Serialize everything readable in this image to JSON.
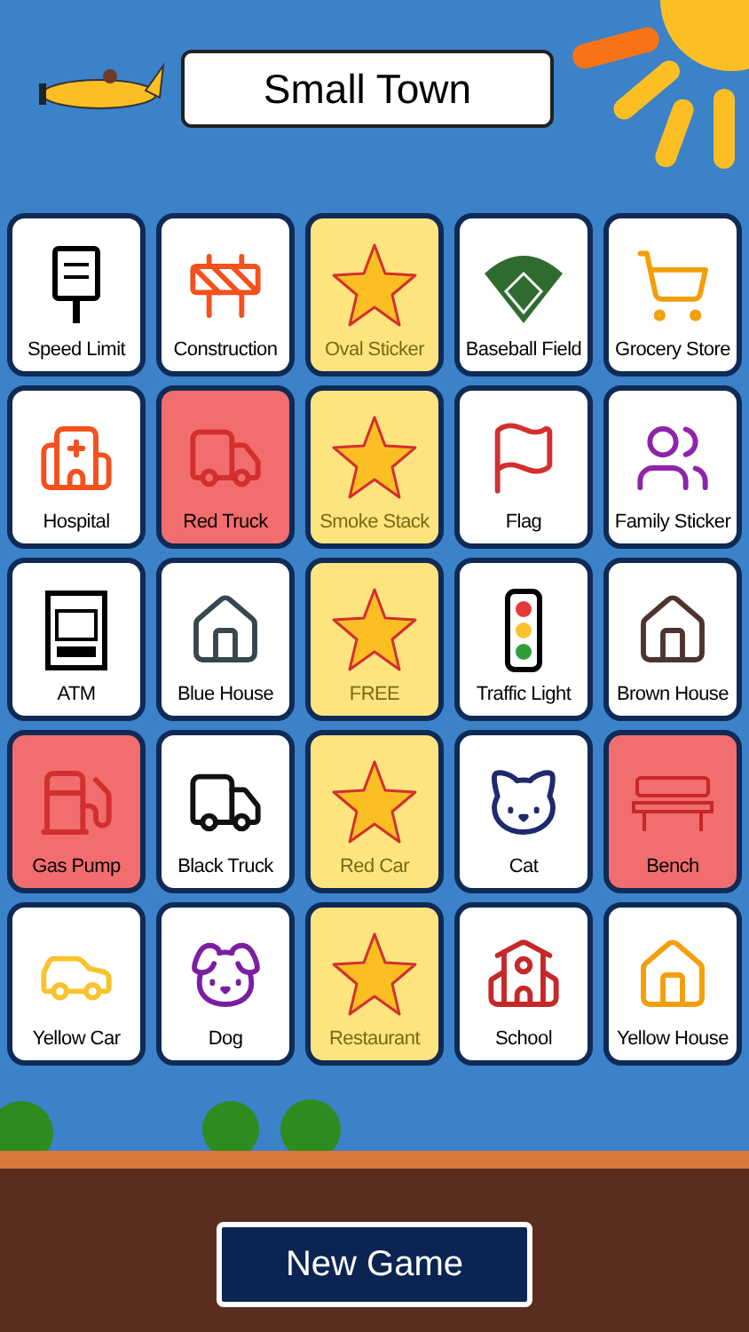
{
  "title": "Small Town",
  "cells": [
    {
      "label": "Speed Limit",
      "marked": false,
      "starred": false
    },
    {
      "label": "Construction",
      "marked": false,
      "starred": false
    },
    {
      "label": "Oval Sticker",
      "marked": false,
      "starred": true
    },
    {
      "label": "Baseball Field",
      "marked": false,
      "starred": false
    },
    {
      "label": "Grocery Store",
      "marked": false,
      "starred": false
    },
    {
      "label": "Hospital",
      "marked": false,
      "starred": false
    },
    {
      "label": "Red Truck",
      "marked": true,
      "starred": false
    },
    {
      "label": "Smoke Stack",
      "marked": false,
      "starred": true
    },
    {
      "label": "Flag",
      "marked": false,
      "starred": false
    },
    {
      "label": "Family Sticker",
      "marked": false,
      "starred": false
    },
    {
      "label": "ATM",
      "marked": false,
      "starred": false
    },
    {
      "label": "Blue House",
      "marked": false,
      "starred": false
    },
    {
      "label": "FREE",
      "marked": false,
      "starred": true
    },
    {
      "label": "Traffic Light",
      "marked": false,
      "starred": false
    },
    {
      "label": "Brown House",
      "marked": false,
      "starred": false
    },
    {
      "label": "Gas Pump",
      "marked": true,
      "starred": false
    },
    {
      "label": "Black Truck",
      "marked": false,
      "starred": false
    },
    {
      "label": "Red Car",
      "marked": false,
      "starred": true
    },
    {
      "label": "Cat",
      "marked": false,
      "starred": false
    },
    {
      "label": "Bench",
      "marked": true,
      "starred": false
    },
    {
      "label": "Yellow Car",
      "marked": false,
      "starred": false
    },
    {
      "label": "Dog",
      "marked": false,
      "starred": false
    },
    {
      "label": "Restaurant",
      "marked": false,
      "starred": true
    },
    {
      "label": "School",
      "marked": false,
      "starred": false
    },
    {
      "label": "Yellow House",
      "marked": false,
      "starred": false
    }
  ],
  "button": "New Game"
}
